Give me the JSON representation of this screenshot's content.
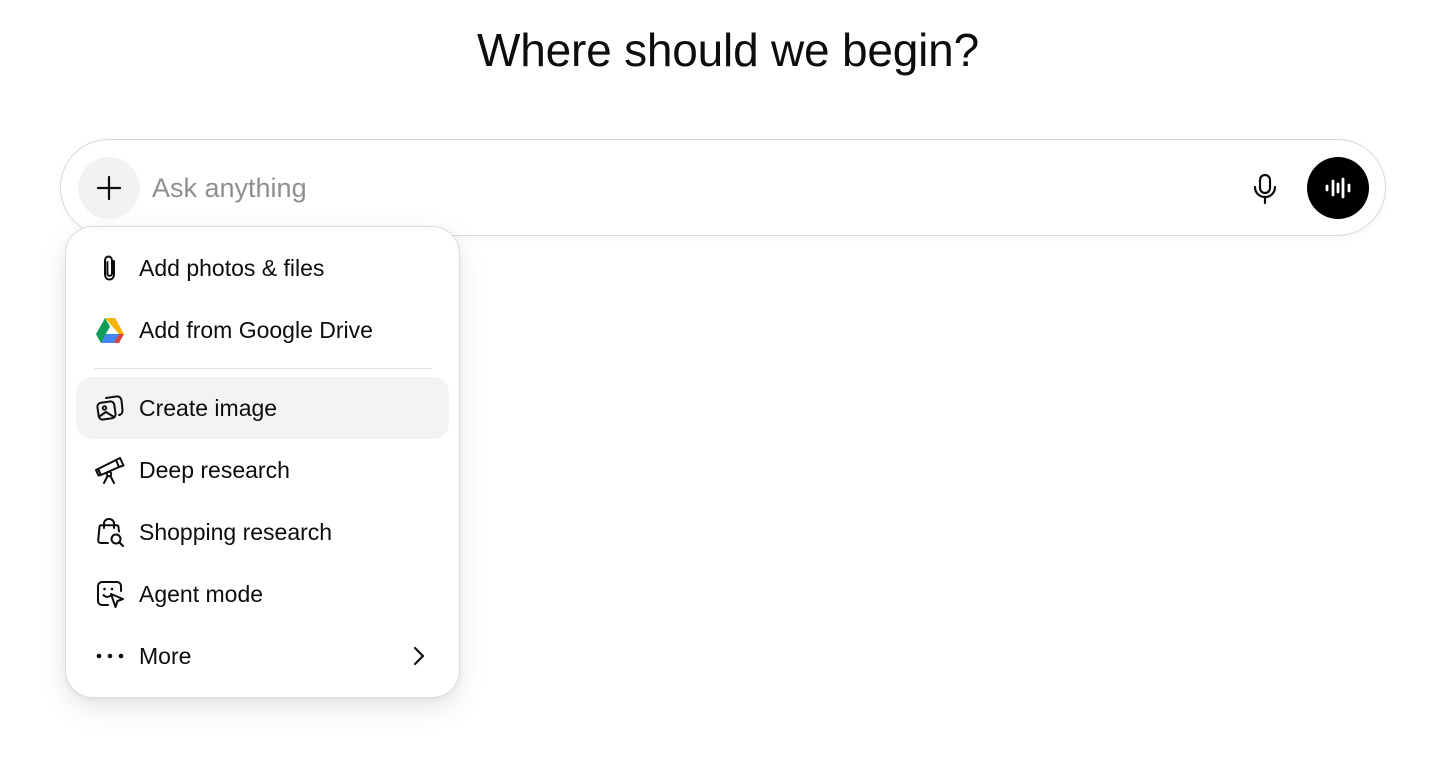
{
  "page": {
    "title": "Where should we begin?"
  },
  "composer": {
    "placeholder": "Ask anything",
    "value": "",
    "plus_icon": "plus-icon",
    "mic_icon": "microphone-icon",
    "voice_icon": "voice-waveform-icon"
  },
  "menu": {
    "items": [
      {
        "label": "Add photos & files",
        "icon": "paperclip-icon"
      },
      {
        "label": "Add from Google Drive",
        "icon": "google-drive-icon"
      },
      {
        "label": "Create image",
        "icon": "image-create-icon",
        "highlighted": true
      },
      {
        "label": "Deep research",
        "icon": "telescope-icon"
      },
      {
        "label": "Shopping research",
        "icon": "shopping-bag-search-icon"
      },
      {
        "label": "Agent mode",
        "icon": "agent-cursor-icon"
      },
      {
        "label": "More",
        "icon": "ellipsis-icon",
        "submenu_icon": "chevron-right-icon"
      }
    ]
  },
  "colors": {
    "text": "#0d0d0d",
    "placeholder": "#8f8f8f",
    "border": "#d9d9d9",
    "highlight": "#f3f3f3",
    "voice_button": "#000000",
    "drive_green": "#0F9D58",
    "drive_yellow": "#F4B400",
    "drive_blue": "#4285F4",
    "drive_red": "#DB4437"
  }
}
